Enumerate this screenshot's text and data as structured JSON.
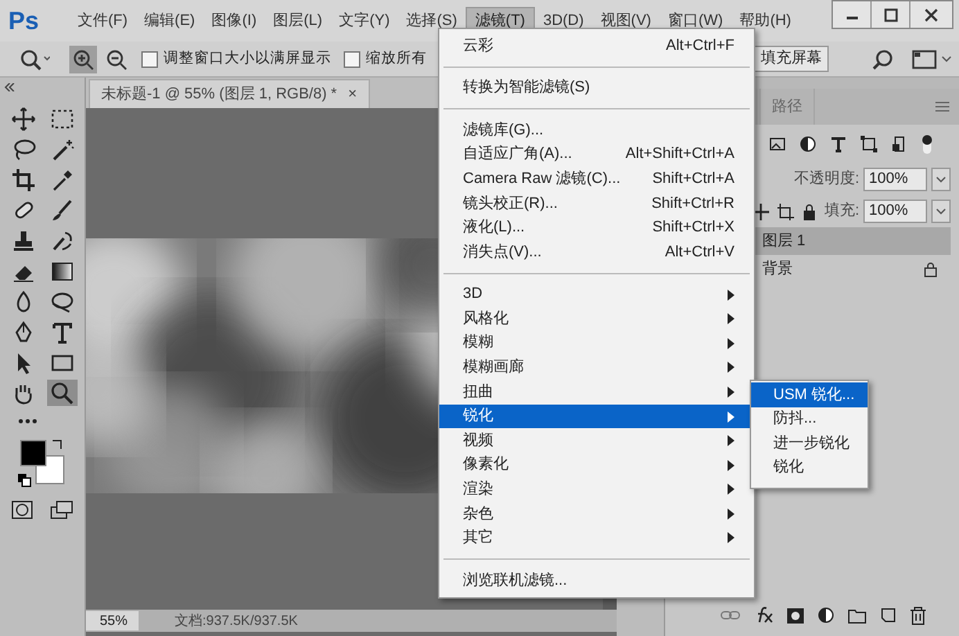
{
  "logo": "Ps",
  "menubar": [
    {
      "label": "文件(F)",
      "selected": false
    },
    {
      "label": "编辑(E)",
      "selected": false
    },
    {
      "label": "图像(I)",
      "selected": false
    },
    {
      "label": "图层(L)",
      "selected": false
    },
    {
      "label": "文字(Y)",
      "selected": false
    },
    {
      "label": "选择(S)",
      "selected": false
    },
    {
      "label": "滤镜(T)",
      "selected": true
    },
    {
      "label": "3D(D)",
      "selected": false
    },
    {
      "label": "视图(V)",
      "selected": false
    },
    {
      "label": "窗口(W)",
      "selected": false
    },
    {
      "label": "帮助(H)",
      "selected": false
    }
  ],
  "options_bar": {
    "checkboxes": [
      {
        "label": "调整窗口大小以满屏显示",
        "checked": false
      },
      {
        "label": "缩放所有",
        "checked": false
      }
    ],
    "fill_screen_button": "填充屏幕"
  },
  "tools": [
    {
      "kind": "move",
      "selected": false
    },
    {
      "kind": "marquee",
      "selected": false
    },
    {
      "kind": "lasso",
      "selected": false
    },
    {
      "kind": "wand",
      "selected": false
    },
    {
      "kind": "crop",
      "selected": false
    },
    {
      "kind": "eyedropper",
      "selected": false
    },
    {
      "kind": "bandage",
      "selected": false
    },
    {
      "kind": "brush",
      "selected": false
    },
    {
      "kind": "stamp",
      "selected": false
    },
    {
      "kind": "history",
      "selected": false
    },
    {
      "kind": "eraser",
      "selected": false
    },
    {
      "kind": "gradient",
      "selected": false
    },
    {
      "kind": "blur",
      "selected": false
    },
    {
      "kind": "dodge",
      "selected": false
    },
    {
      "kind": "pen",
      "selected": false
    },
    {
      "kind": "type",
      "selected": false
    },
    {
      "kind": "arrow",
      "selected": false
    },
    {
      "kind": "rectangle",
      "selected": false
    },
    {
      "kind": "hand",
      "selected": false
    },
    {
      "kind": "zoom",
      "selected": true
    }
  ],
  "document_tab": {
    "title": "未标题-1 @ 55% (图层 1, RGB/8) *",
    "close": "×"
  },
  "filter_menu": [
    {
      "kind": "item",
      "label": "云彩",
      "shortcut": "Alt+Ctrl+F",
      "selected": false,
      "submenu": false
    },
    {
      "kind": "separator"
    },
    {
      "kind": "item",
      "label": "转换为智能滤镜(S)",
      "selected": false,
      "submenu": false
    },
    {
      "kind": "separator"
    },
    {
      "kind": "item",
      "label": "滤镜库(G)...",
      "selected": false,
      "submenu": false
    },
    {
      "kind": "item",
      "label": "自适应广角(A)...",
      "shortcut": "Alt+Shift+Ctrl+A",
      "selected": false,
      "submenu": false
    },
    {
      "kind": "item",
      "label": "Camera Raw 滤镜(C)...",
      "shortcut": "Shift+Ctrl+A",
      "selected": false,
      "submenu": false
    },
    {
      "kind": "item",
      "label": "镜头校正(R)...",
      "shortcut": "Shift+Ctrl+R",
      "selected": false,
      "submenu": false
    },
    {
      "kind": "item",
      "label": "液化(L)...",
      "shortcut": "Shift+Ctrl+X",
      "selected": false,
      "submenu": false
    },
    {
      "kind": "item",
      "label": "消失点(V)...",
      "shortcut": "Alt+Ctrl+V",
      "selected": false,
      "submenu": false
    },
    {
      "kind": "separator"
    },
    {
      "kind": "item",
      "label": "3D",
      "selected": false,
      "submenu": true
    },
    {
      "kind": "item",
      "label": "风格化",
      "selected": false,
      "submenu": true
    },
    {
      "kind": "item",
      "label": "模糊",
      "selected": false,
      "submenu": true
    },
    {
      "kind": "item",
      "label": "模糊画廊",
      "selected": false,
      "submenu": true
    },
    {
      "kind": "item",
      "label": "扭曲",
      "selected": false,
      "submenu": true
    },
    {
      "kind": "item",
      "label": "锐化",
      "selected": true,
      "submenu": true
    },
    {
      "kind": "item",
      "label": "视频",
      "selected": false,
      "submenu": true
    },
    {
      "kind": "item",
      "label": "像素化",
      "selected": false,
      "submenu": true
    },
    {
      "kind": "item",
      "label": "渲染",
      "selected": false,
      "submenu": true
    },
    {
      "kind": "item",
      "label": "杂色",
      "selected": false,
      "submenu": true
    },
    {
      "kind": "item",
      "label": "其它",
      "selected": false,
      "submenu": true
    },
    {
      "kind": "separator"
    },
    {
      "kind": "item",
      "label": "浏览联机滤镜...",
      "selected": false,
      "submenu": false
    }
  ],
  "sharpen_submenu": [
    {
      "label": "USM 锐化...",
      "selected": true
    },
    {
      "label": "防抖...",
      "selected": false
    },
    {
      "label": "进一步锐化",
      "selected": false
    },
    {
      "label": "锐化",
      "selected": false
    }
  ],
  "layers_panel": {
    "tab": "路径",
    "opacity_label": "不透明度:",
    "opacity": "100%",
    "fill_label": "填充:",
    "fill": "100%",
    "layers": [
      {
        "name": "图层 1",
        "selected": true,
        "locked": false
      },
      {
        "name": "背景",
        "selected": false,
        "locked": true
      }
    ]
  },
  "status_bar": {
    "zoom": "55%",
    "document": "文档:937.5K/937.5K"
  }
}
